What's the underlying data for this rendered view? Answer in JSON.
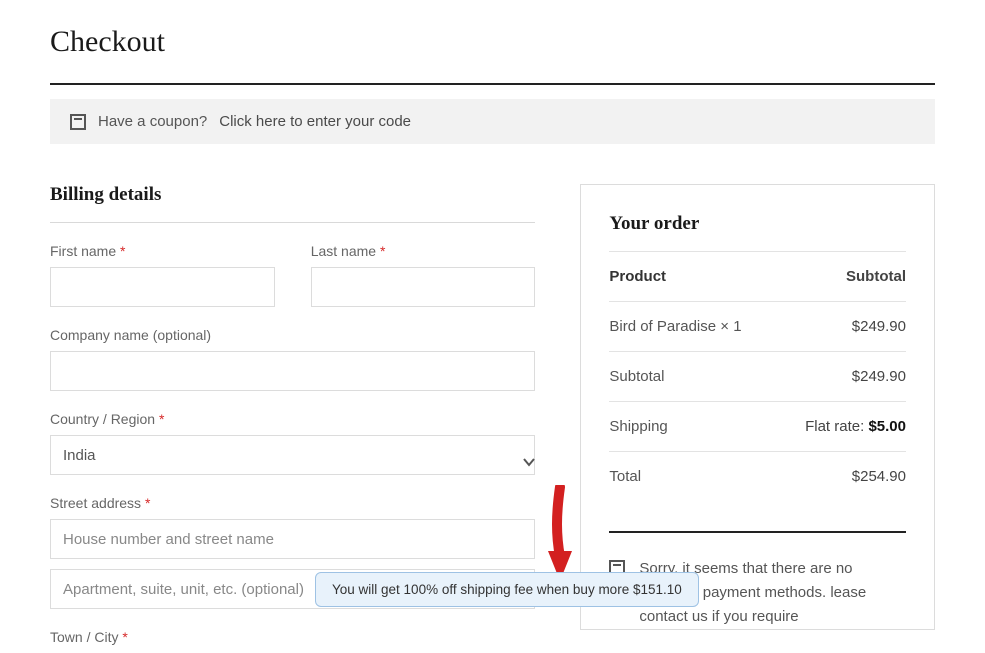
{
  "page": {
    "title": "Checkout"
  },
  "coupon": {
    "prompt": "Have a coupon?",
    "link": "Click here to enter your code"
  },
  "billing": {
    "heading": "Billing details",
    "first_name_label": "First name",
    "last_name_label": "Last name",
    "company_label": "Company name (optional)",
    "country_label": "Country / Region",
    "country_value": "India",
    "street_label": "Street address",
    "street_placeholder1": "House number and street name",
    "street_placeholder2": "Apartment, suite, unit, etc. (optional)",
    "town_label": "Town / City"
  },
  "order": {
    "heading": "Your order",
    "col_product": "Product",
    "col_subtotal": "Subtotal",
    "items": [
      {
        "name": "Bird of Paradise × 1",
        "price": "$249.90"
      }
    ],
    "subtotal_label": "Subtotal",
    "subtotal_value": "$249.90",
    "shipping_label": "Shipping",
    "shipping_rate_prefix": "Flat rate:",
    "shipping_rate_value": "$5.00",
    "total_label": "Total",
    "total_value": "$254.90",
    "payment_notice": "Sorry, it seems that there are no available payment methods. lease contact us if you require"
  },
  "promo": {
    "text": "You will get 100% off shipping fee when buy more $151.10"
  },
  "required_mark": "*"
}
